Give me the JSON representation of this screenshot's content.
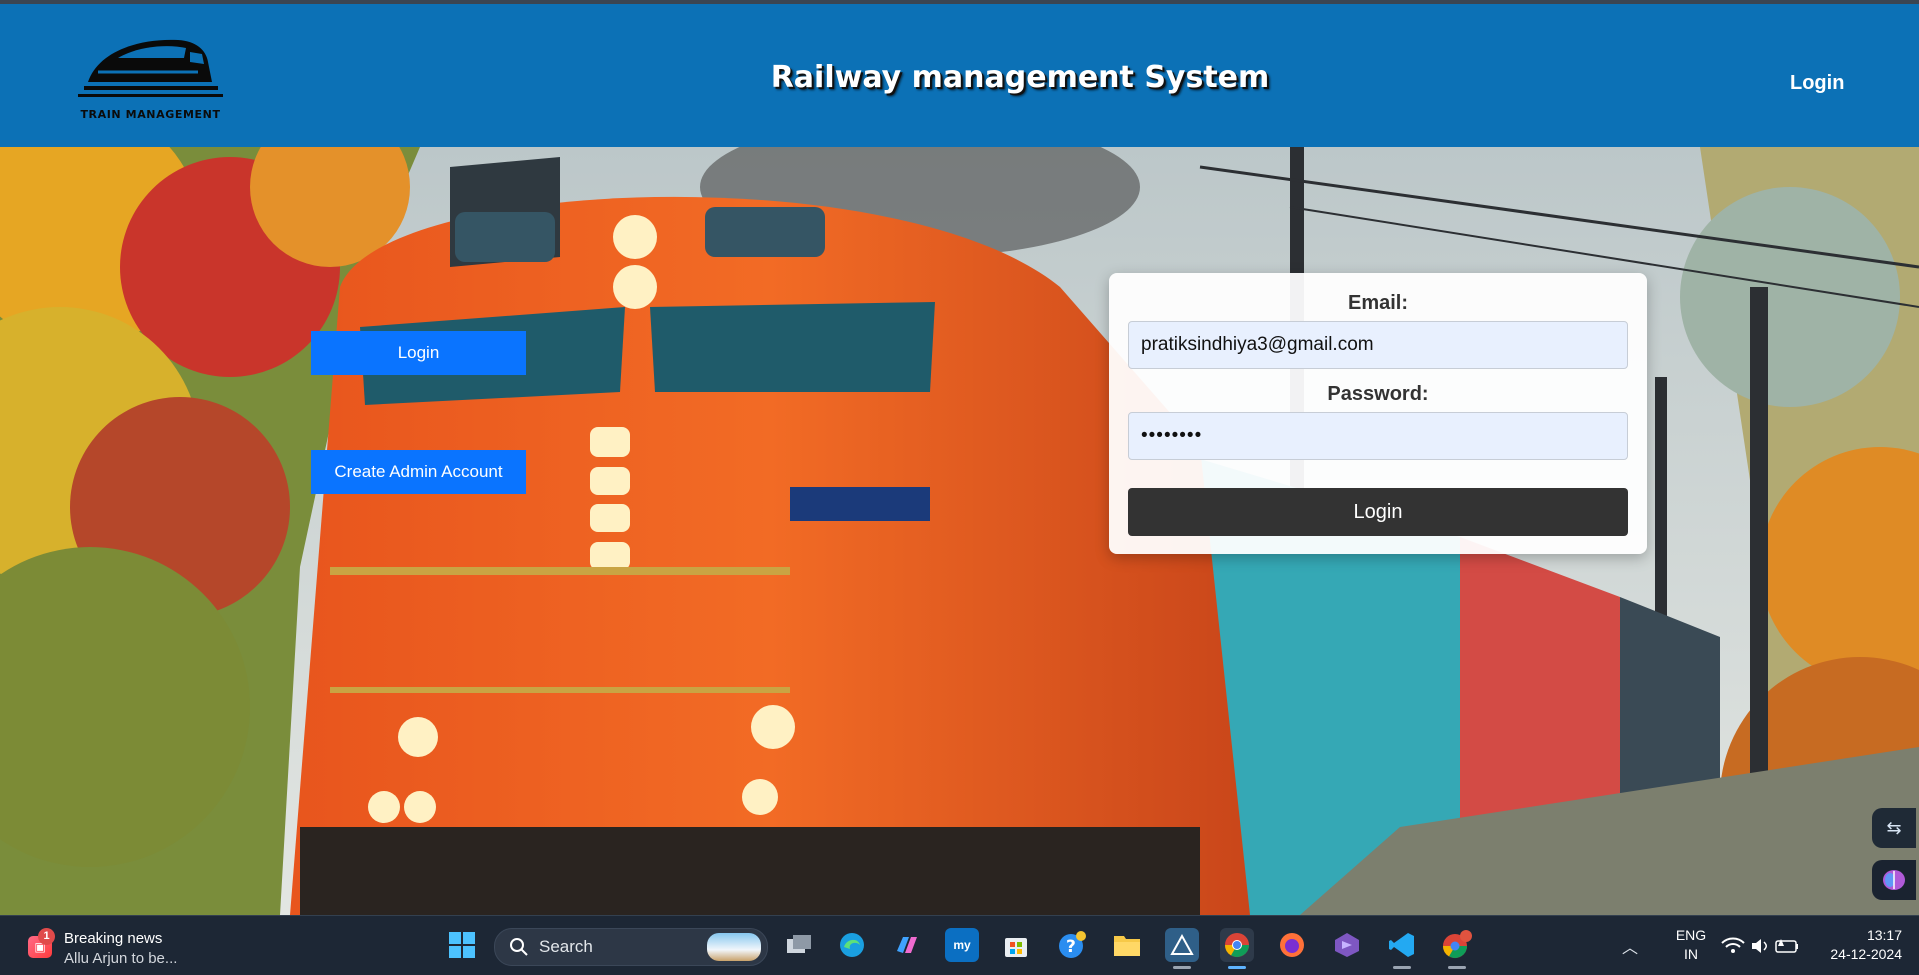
{
  "header": {
    "logo_text": "TRAIN MANAGEMENT",
    "title": "Railway management System",
    "login_link": "Login"
  },
  "side_buttons": {
    "login": "Login",
    "create_admin": "Create Admin Account"
  },
  "login_form": {
    "email_label": "Email:",
    "email_value": "pratiksindhiya3@gmail.com",
    "password_label": "Password:",
    "password_value": "••••••••",
    "submit_label": "Login"
  },
  "taskbar": {
    "news_title": "Breaking news",
    "news_sub": "Allu Arjun to be...",
    "news_badge": "1",
    "search_placeholder": "Search",
    "language_line1": "ENG",
    "language_line2": "IN",
    "time": "13:17",
    "date": "24-12-2024",
    "apps": [
      "windows-start",
      "task-view",
      "edge",
      "copilot",
      "myhp",
      "microsoft-store",
      "get-help",
      "file-explorer",
      "vpn-app",
      "chrome",
      "firefox",
      "visual-studio",
      "vs-code",
      "chrome-profile"
    ]
  },
  "colors": {
    "header_bg": "#0c71b6",
    "button_blue": "#0a74ff",
    "submit_dark": "#333333",
    "input_bg": "#e8f0fe",
    "taskbar_bg": "#1d2735"
  }
}
